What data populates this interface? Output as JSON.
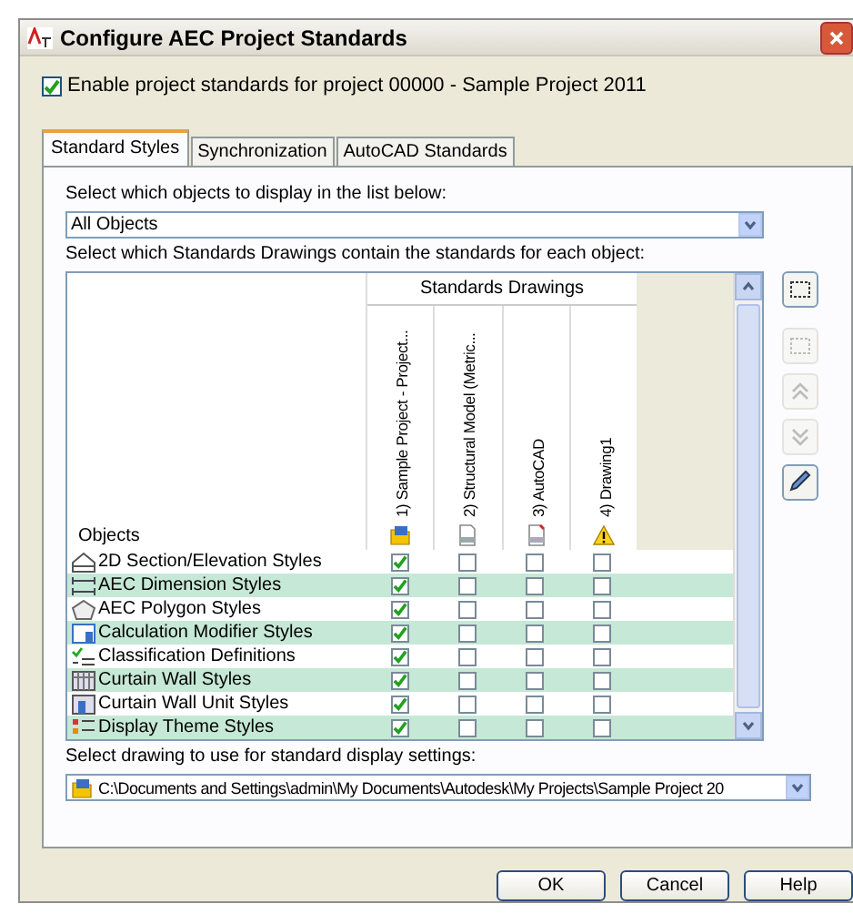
{
  "window": {
    "title": "Configure AEC Project Standards"
  },
  "enable_checkbox": {
    "label": "Enable project standards for project 00000 - Sample Project 2011",
    "checked": true
  },
  "tabs": [
    {
      "label": "Standard Styles",
      "selected": true
    },
    {
      "label": "Synchronization",
      "selected": false
    },
    {
      "label": "AutoCAD Standards",
      "selected": false
    }
  ],
  "filter_label": "Select which objects to display in the list below:",
  "filter_dropdown": {
    "value": "All Objects"
  },
  "grid_label": "Select which Standards Drawings contain the standards for each object:",
  "grid": {
    "objects_header": "Objects",
    "group_header": "Standards Drawings",
    "columns": [
      {
        "label": "1) Sample Project - Project...",
        "kind": "project"
      },
      {
        "label": "2) Structural Model (Metric...",
        "kind": "dwt"
      },
      {
        "label": "3) AutoCAD",
        "kind": "dws"
      },
      {
        "label": "4) Drawing1",
        "kind": "warning"
      }
    ],
    "rows": [
      {
        "name": "2D Section/Elevation Styles",
        "kind": "section",
        "checks": [
          true,
          false,
          false,
          false
        ]
      },
      {
        "name": "AEC Dimension Styles",
        "kind": "dimension",
        "checks": [
          true,
          false,
          false,
          false
        ]
      },
      {
        "name": "AEC Polygon Styles",
        "kind": "polygon",
        "checks": [
          true,
          false,
          false,
          false
        ]
      },
      {
        "name": "Calculation Modifier Styles",
        "kind": "calc",
        "checks": [
          true,
          false,
          false,
          false
        ]
      },
      {
        "name": "Classification Definitions",
        "kind": "classification",
        "checks": [
          true,
          false,
          false,
          false
        ]
      },
      {
        "name": "Curtain Wall Styles",
        "kind": "curtain",
        "checks": [
          true,
          false,
          false,
          false
        ]
      },
      {
        "name": "Curtain Wall Unit Styles",
        "kind": "unit",
        "checks": [
          true,
          false,
          false,
          false
        ]
      },
      {
        "name": "Display Theme Styles",
        "kind": "theme",
        "checks": [
          true,
          false,
          false,
          false
        ]
      }
    ]
  },
  "side_buttons": [
    {
      "kind": "add",
      "disabled": false
    },
    {
      "kind": "remove",
      "disabled": true
    },
    {
      "kind": "up",
      "disabled": true
    },
    {
      "kind": "down",
      "disabled": true
    },
    {
      "kind": "edit",
      "disabled": false
    }
  ],
  "display_label": "Select drawing to use for standard display settings:",
  "display_dropdown": {
    "value": "C:\\Documents and Settings\\admin\\My Documents\\Autodesk\\My Projects\\Sample Project 20"
  },
  "buttons": [
    "OK",
    "Cancel",
    "Help"
  ]
}
